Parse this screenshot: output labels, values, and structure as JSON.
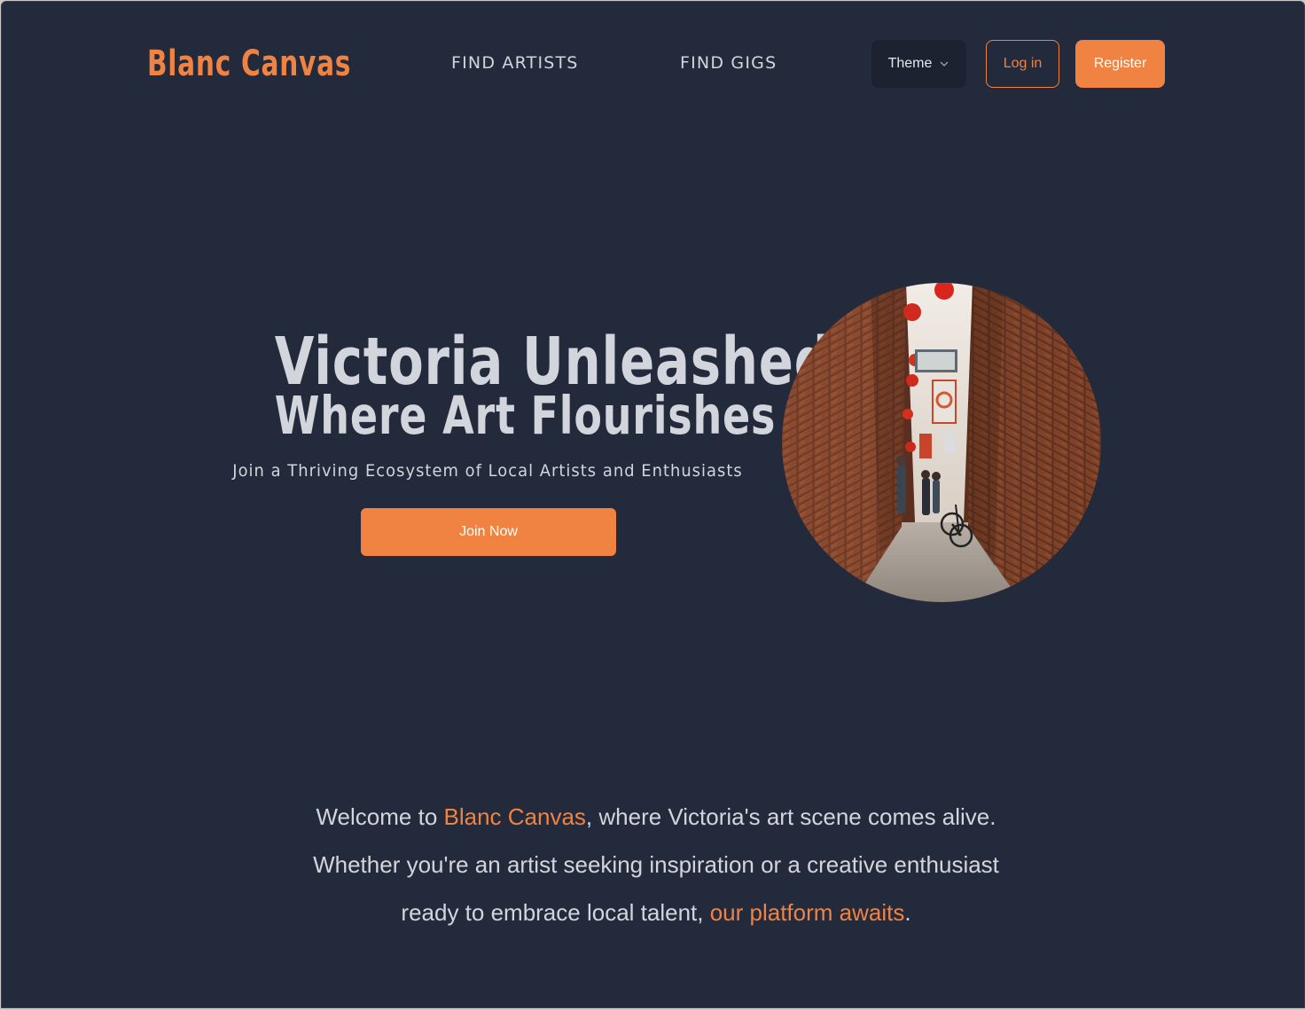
{
  "nav": {
    "logo": "Blanc Canvas",
    "links": [
      "FIND ARTISTS",
      "FIND GIGS"
    ],
    "theme_label": "Theme",
    "login_label": "Log in",
    "register_label": "Register"
  },
  "hero": {
    "title_line1": "Victoria Unleashed",
    "title_line2": "Where Art Flourishes",
    "subtitle": "Join a Thriving Ecosystem of Local Artists and Enthusiasts",
    "cta_label": "Join Now",
    "image_icon": "alley-photo"
  },
  "welcome": {
    "line1_prefix": "Welcome to ",
    "line1_highlight": "Blanc Canvas",
    "line1_suffix": ", where Victoria's art scene comes alive.",
    "line2": "Whether you're an artist seeking inspiration or a creative enthusiast",
    "line3_prefix": "ready to embrace local talent, ",
    "line3_highlight": "our platform awaits",
    "line3_suffix": "."
  },
  "colors": {
    "background": "#232a3b",
    "accent": "#f08341",
    "text": "#d3d5dc"
  }
}
